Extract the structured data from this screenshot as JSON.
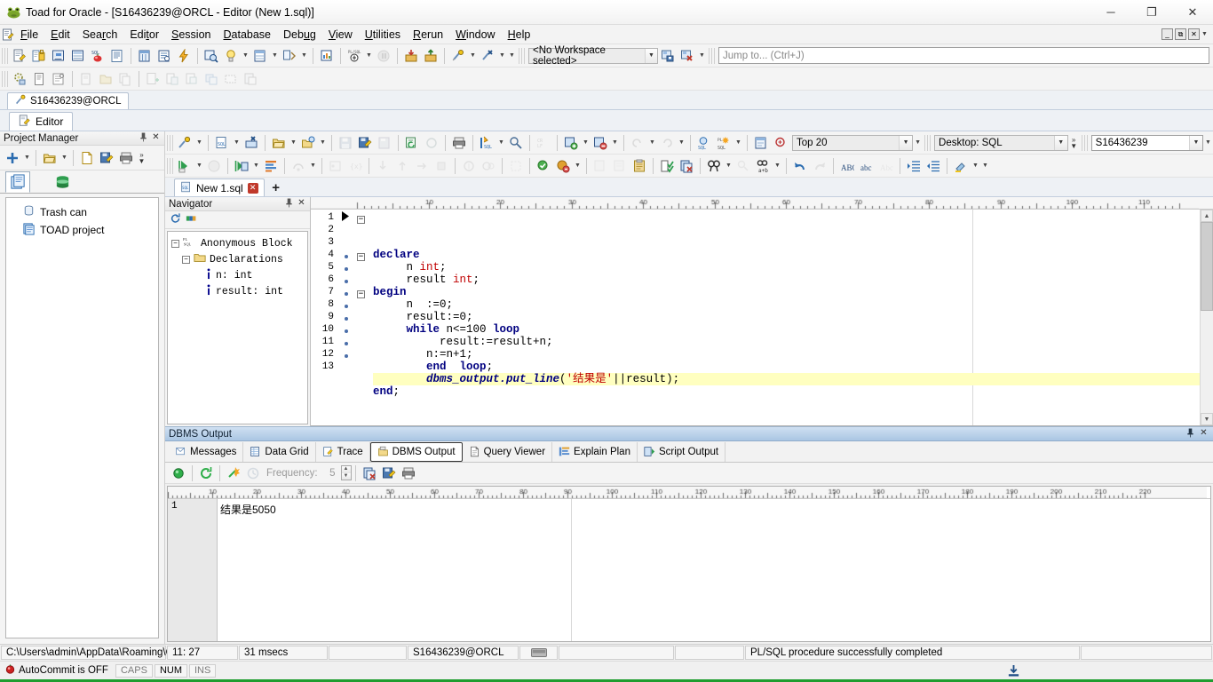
{
  "window": {
    "title": "Toad for Oracle - [S16436239@ORCL - Editor (New 1.sql)]",
    "app_icon": "toad-frog-icon",
    "minimize": "─",
    "maximize": "❐",
    "close": "✕",
    "mdi_minimize": "_",
    "mdi_restore": "❐",
    "mdi_close": "✕"
  },
  "menu": {
    "items": [
      {
        "label": "File",
        "accel": "F"
      },
      {
        "label": "Edit",
        "accel": "E"
      },
      {
        "label": "Search",
        "accel": "r"
      },
      {
        "label": "Editor",
        "accel": "t"
      },
      {
        "label": "Session",
        "accel": "S"
      },
      {
        "label": "Database",
        "accel": "D"
      },
      {
        "label": "Debug",
        "accel": "u"
      },
      {
        "label": "View",
        "accel": "V"
      },
      {
        "label": "Utilities",
        "accel": "U"
      },
      {
        "label": "Rerun",
        "accel": "R"
      },
      {
        "label": "Window",
        "accel": "W"
      },
      {
        "label": "Help",
        "accel": "H"
      }
    ]
  },
  "main_toolbar": {
    "workspace_combo": "<No Workspace selected>",
    "jump_to_placeholder": "Jump to... (Ctrl+J)",
    "buttons": [
      "new-editor-icon",
      "schema-browser-icon",
      "sql-monitor-icon",
      "session-browser-icon",
      "sql-tuning-icon",
      "report-icon",
      "database-browser-icon",
      "describe-icon",
      "execute-flash-icon",
      "find-objects-icon",
      "explain-plan-icon",
      "data-grid-icon",
      "compare-icon",
      "chart-icon",
      "plsql-debug-icon",
      "pause-icon",
      "commit-icon",
      "rollback-icon",
      "new-connection-icon",
      "close-connection-icon",
      "save-workspace-icon",
      "delete-workspace-icon"
    ],
    "row2_buttons": [
      "project-settings-icon",
      "properties-icon",
      "configure-icon",
      "open-file-icon",
      "add-folder-icon",
      "copy-icon",
      "new-doc-icon",
      "new-from-icon",
      "new-group-icon",
      "duplicate-icon",
      "rename-icon",
      "paste-special-icon"
    ]
  },
  "connection_tab": {
    "label": "S16436239@ORCL",
    "icon": "connection-plug-icon"
  },
  "editor_window_tab": {
    "label": "Editor",
    "icon": "editor-pencil-icon"
  },
  "project_manager": {
    "title": "Project Manager",
    "pin": "📌",
    "close": "✕",
    "toolbar": [
      "add-plus-icon",
      "open-folder-icon",
      "new-file-icon",
      "save-file-icon",
      "print-icon"
    ],
    "overflow": "»",
    "tabs": [
      "project-tab-icon",
      "database-tab-icon"
    ],
    "tree": [
      {
        "label": "Trash can",
        "icon": "trash-can-icon"
      },
      {
        "label": "TOAD project",
        "icon": "project-folder-icon"
      }
    ]
  },
  "editor_toolbar": {
    "top20_label": "Top 20",
    "desktop_label": "Desktop:  SQL",
    "schema_label": "S16436239",
    "overflow": "»",
    "row1_icons": [
      "connection-icon",
      "new-sql-icon",
      "close-sql-icon",
      "open-icon",
      "open-recent-icon",
      "save-icon",
      "save-as-icon",
      "save-all-icon",
      "refresh-sql-icon",
      "sync-icon",
      "print-icon",
      "execute-statement-icon",
      "execute-explain-icon",
      "format-icon",
      "add-bookmark-icon",
      "remove-bookmark-icon",
      "undo-nav-icon",
      "redo-nav-icon",
      "run-sql-icon",
      "run-plsql-icon",
      "top-records-icon",
      "filter-icon"
    ],
    "row2_icons": [
      "execute-script-icon",
      "execute-current-icon",
      "run-as-script-icon",
      "script-output-icon",
      "step-over-icon",
      "set-breakpoint-icon",
      "watch-icon",
      "trace-into-icon",
      "step-out-icon",
      "run-to-cursor-icon",
      "halt-icon",
      "param-icon",
      "params2-icon",
      "compile-icon",
      "compile-debug-icon",
      "compile-deps-icon",
      "strip-code-icon",
      "paste-grid-icon",
      "clipboard-icon",
      "check-syntax-icon",
      "recall-icon",
      "find-icon",
      "find-next-icon",
      "replace-icon",
      "undo-icon",
      "redo-icon",
      "uppercase-icon",
      "lowercase-icon",
      "titlecase-icon",
      "indent-icon",
      "outdent-icon",
      "highlight-icon"
    ]
  },
  "sql_tab": {
    "label": "New 1.sql",
    "icon": "sql-file-icon",
    "close": "✕",
    "add_tab": "+"
  },
  "navigator": {
    "title": "Navigator",
    "pin": "📌",
    "close": "✕",
    "toolbar": [
      "refresh-icon",
      "colorbar-icon"
    ],
    "tree": [
      {
        "label": "Anonymous Block",
        "icon": "plsql-icon",
        "depth": 0,
        "expander": "−"
      },
      {
        "label": "Declarations",
        "icon": "folder-icon",
        "depth": 1,
        "expander": "−"
      },
      {
        "label": "n: int",
        "icon": "info-icon",
        "depth": 2,
        "expander": ""
      },
      {
        "label": "result: int",
        "icon": "info-icon",
        "depth": 2,
        "expander": ""
      }
    ]
  },
  "code": {
    "ruler_max": 115,
    "current_line": 11,
    "lines": [
      {
        "n": 1,
        "mark": false,
        "fold": "−",
        "marker": "run-arrow",
        "text": "declare"
      },
      {
        "n": 2,
        "mark": false,
        "fold": "",
        "text": "     n int;"
      },
      {
        "n": 3,
        "mark": false,
        "fold": "",
        "text": "     result int;"
      },
      {
        "n": 4,
        "mark": true,
        "fold": "−",
        "text": "begin"
      },
      {
        "n": 5,
        "mark": true,
        "fold": "",
        "text": "     n  :=0;"
      },
      {
        "n": 6,
        "mark": true,
        "fold": "",
        "text": "     result:=0;"
      },
      {
        "n": 7,
        "mark": true,
        "fold": "−",
        "text": "     while n<=100 loop"
      },
      {
        "n": 8,
        "mark": true,
        "fold": "",
        "text": "          result:=result+n;"
      },
      {
        "n": 9,
        "mark": true,
        "fold": "",
        "text": "        n:=n+1;"
      },
      {
        "n": 10,
        "mark": true,
        "fold": "",
        "text": "        end  loop;"
      },
      {
        "n": 11,
        "mark": true,
        "fold": "",
        "text": "        dbms_output.put_line('结果是'||result);"
      },
      {
        "n": 12,
        "mark": true,
        "fold": "",
        "text": "end;"
      },
      {
        "n": 13,
        "mark": false,
        "fold": "",
        "text": ""
      }
    ]
  },
  "output_panel": {
    "caption": "DBMS Output",
    "pin": "📌",
    "close": "✕",
    "tabs": [
      {
        "label": "Messages",
        "icon": "messages-icon",
        "selected": false
      },
      {
        "label": "Data Grid",
        "icon": "grid-icon",
        "selected": false
      },
      {
        "label": "Trace",
        "icon": "trace-icon",
        "selected": false
      },
      {
        "label": "DBMS Output",
        "icon": "dbms-output-icon",
        "selected": true
      },
      {
        "label": "Query Viewer",
        "icon": "query-viewer-icon",
        "selected": false
      },
      {
        "label": "Explain Plan",
        "icon": "explain-plan-icon",
        "selected": false
      },
      {
        "label": "Script Output",
        "icon": "script-output-icon",
        "selected": false
      }
    ],
    "toolbar": {
      "toggle_icon": "green-status-icon",
      "refresh_icon": "refresh-icon",
      "poll_icon": "poll-on-icon",
      "poll_off_icon": "poll-off-icon",
      "frequency_label": "Frequency:",
      "frequency_value": "5",
      "clear_icon": "clear-output-icon",
      "save_icon": "save-output-icon",
      "print_icon": "print-output-icon"
    },
    "ruler_max": 220,
    "rows": [
      {
        "n": "1",
        "text": "结果是5050"
      }
    ]
  },
  "status_bar": {
    "path": "C:\\Users\\admin\\AppData\\Roaming\\C",
    "cursor": "11:  27",
    "elapsed": "31 msecs",
    "blank1": "",
    "connection": "S16436239@ORCL",
    "keyboard_icon": "keyboard-icon",
    "blank2": "",
    "message": "PL/SQL procedure successfully completed",
    "blank3": ""
  },
  "status_bar2": {
    "autocommit_icon": "red-ball-icon",
    "autocommit": "AutoCommit is OFF",
    "caps": "CAPS",
    "num": "NUM",
    "ins": "INS",
    "download_icon": "download-icon"
  },
  "colors": {
    "keyword": "#000080",
    "type": "#c00000",
    "string": "#c00000",
    "highlight_line": "#ffffc0",
    "caption_blue": "#aac6e3",
    "accent": "#1f9d2f"
  }
}
